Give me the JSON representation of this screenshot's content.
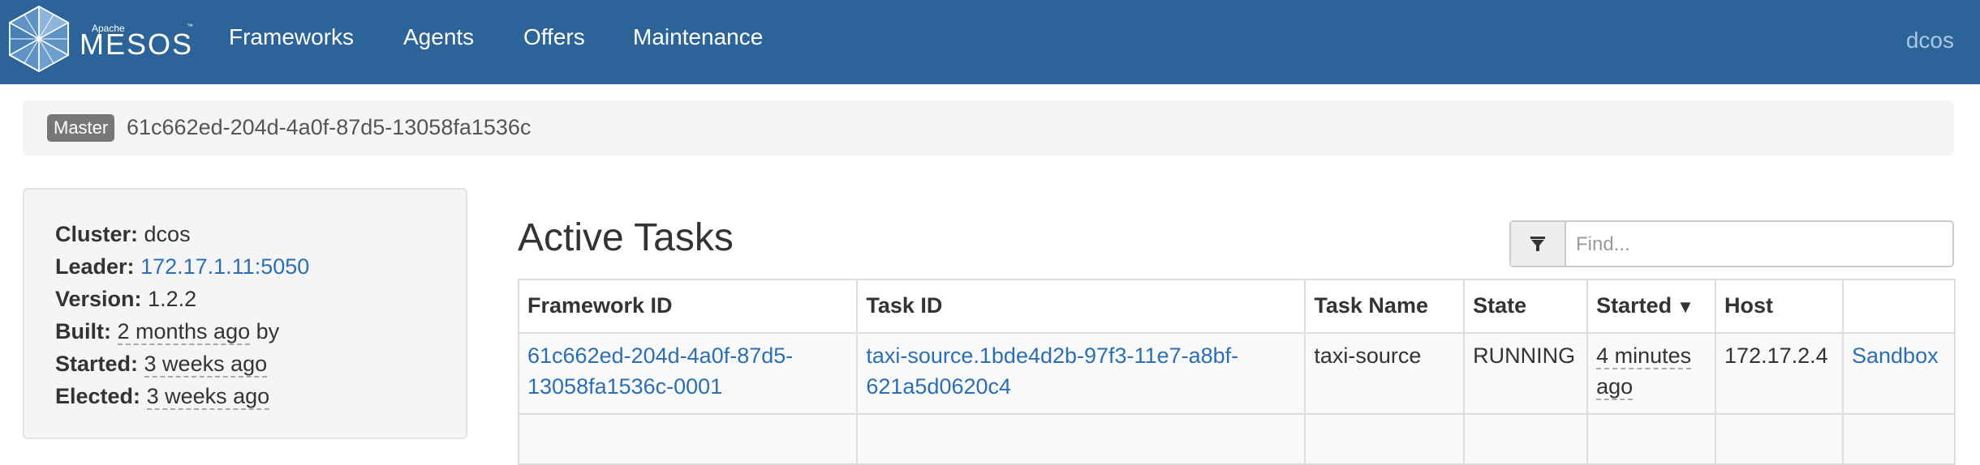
{
  "navbar": {
    "brand_small": "Apache",
    "brand": "MESOS",
    "brand_tm": "™",
    "links": [
      "Frameworks",
      "Agents",
      "Offers",
      "Maintenance"
    ],
    "user": "dcos",
    "colors": {
      "background": "#2c6499",
      "text": "#ffffff",
      "user_text": "#a9c6e3"
    }
  },
  "breadcrumb": {
    "badge": "Master",
    "id": "61c662ed-204d-4a0f-87d5-13058fa1536c"
  },
  "sidebar": {
    "cluster": {
      "label": "Cluster:",
      "value": "dcos"
    },
    "leader": {
      "label": "Leader:",
      "value": "172.17.1.11:5050"
    },
    "version": {
      "label": "Version:",
      "value": "1.2.2"
    },
    "built": {
      "label": "Built:",
      "value": "2 months ago",
      "suffix": "by"
    },
    "started": {
      "label": "Started:",
      "value": "3 weeks ago"
    },
    "elected": {
      "label": "Elected:",
      "value": "3 weeks ago"
    }
  },
  "main": {
    "title": "Active Tasks",
    "search": {
      "placeholder": "Find...",
      "value": "",
      "filter_icon": "filter-icon"
    },
    "table": {
      "headers": [
        "Framework ID",
        "Task ID",
        "Task Name",
        "State",
        "Started",
        "Host",
        ""
      ],
      "sort_indicator": "▼",
      "rows": [
        {
          "framework_id_line1": "61c662ed-204d-4a0f-87d5-",
          "framework_id_line2": "13058fa1536c-0001",
          "task_id_line1": "taxi-source.1bde4d2b-97f3-11e7-a8bf-",
          "task_id_line2": "621a5d0620c4",
          "task_name": "taxi-source",
          "state": "RUNNING",
          "started_line1": "4 minutes",
          "started_line2": "ago",
          "host": "172.17.2.4",
          "sandbox": "Sandbox"
        }
      ]
    },
    "colors": {
      "link": "#2a6fb3",
      "border": "#dddddd"
    }
  }
}
